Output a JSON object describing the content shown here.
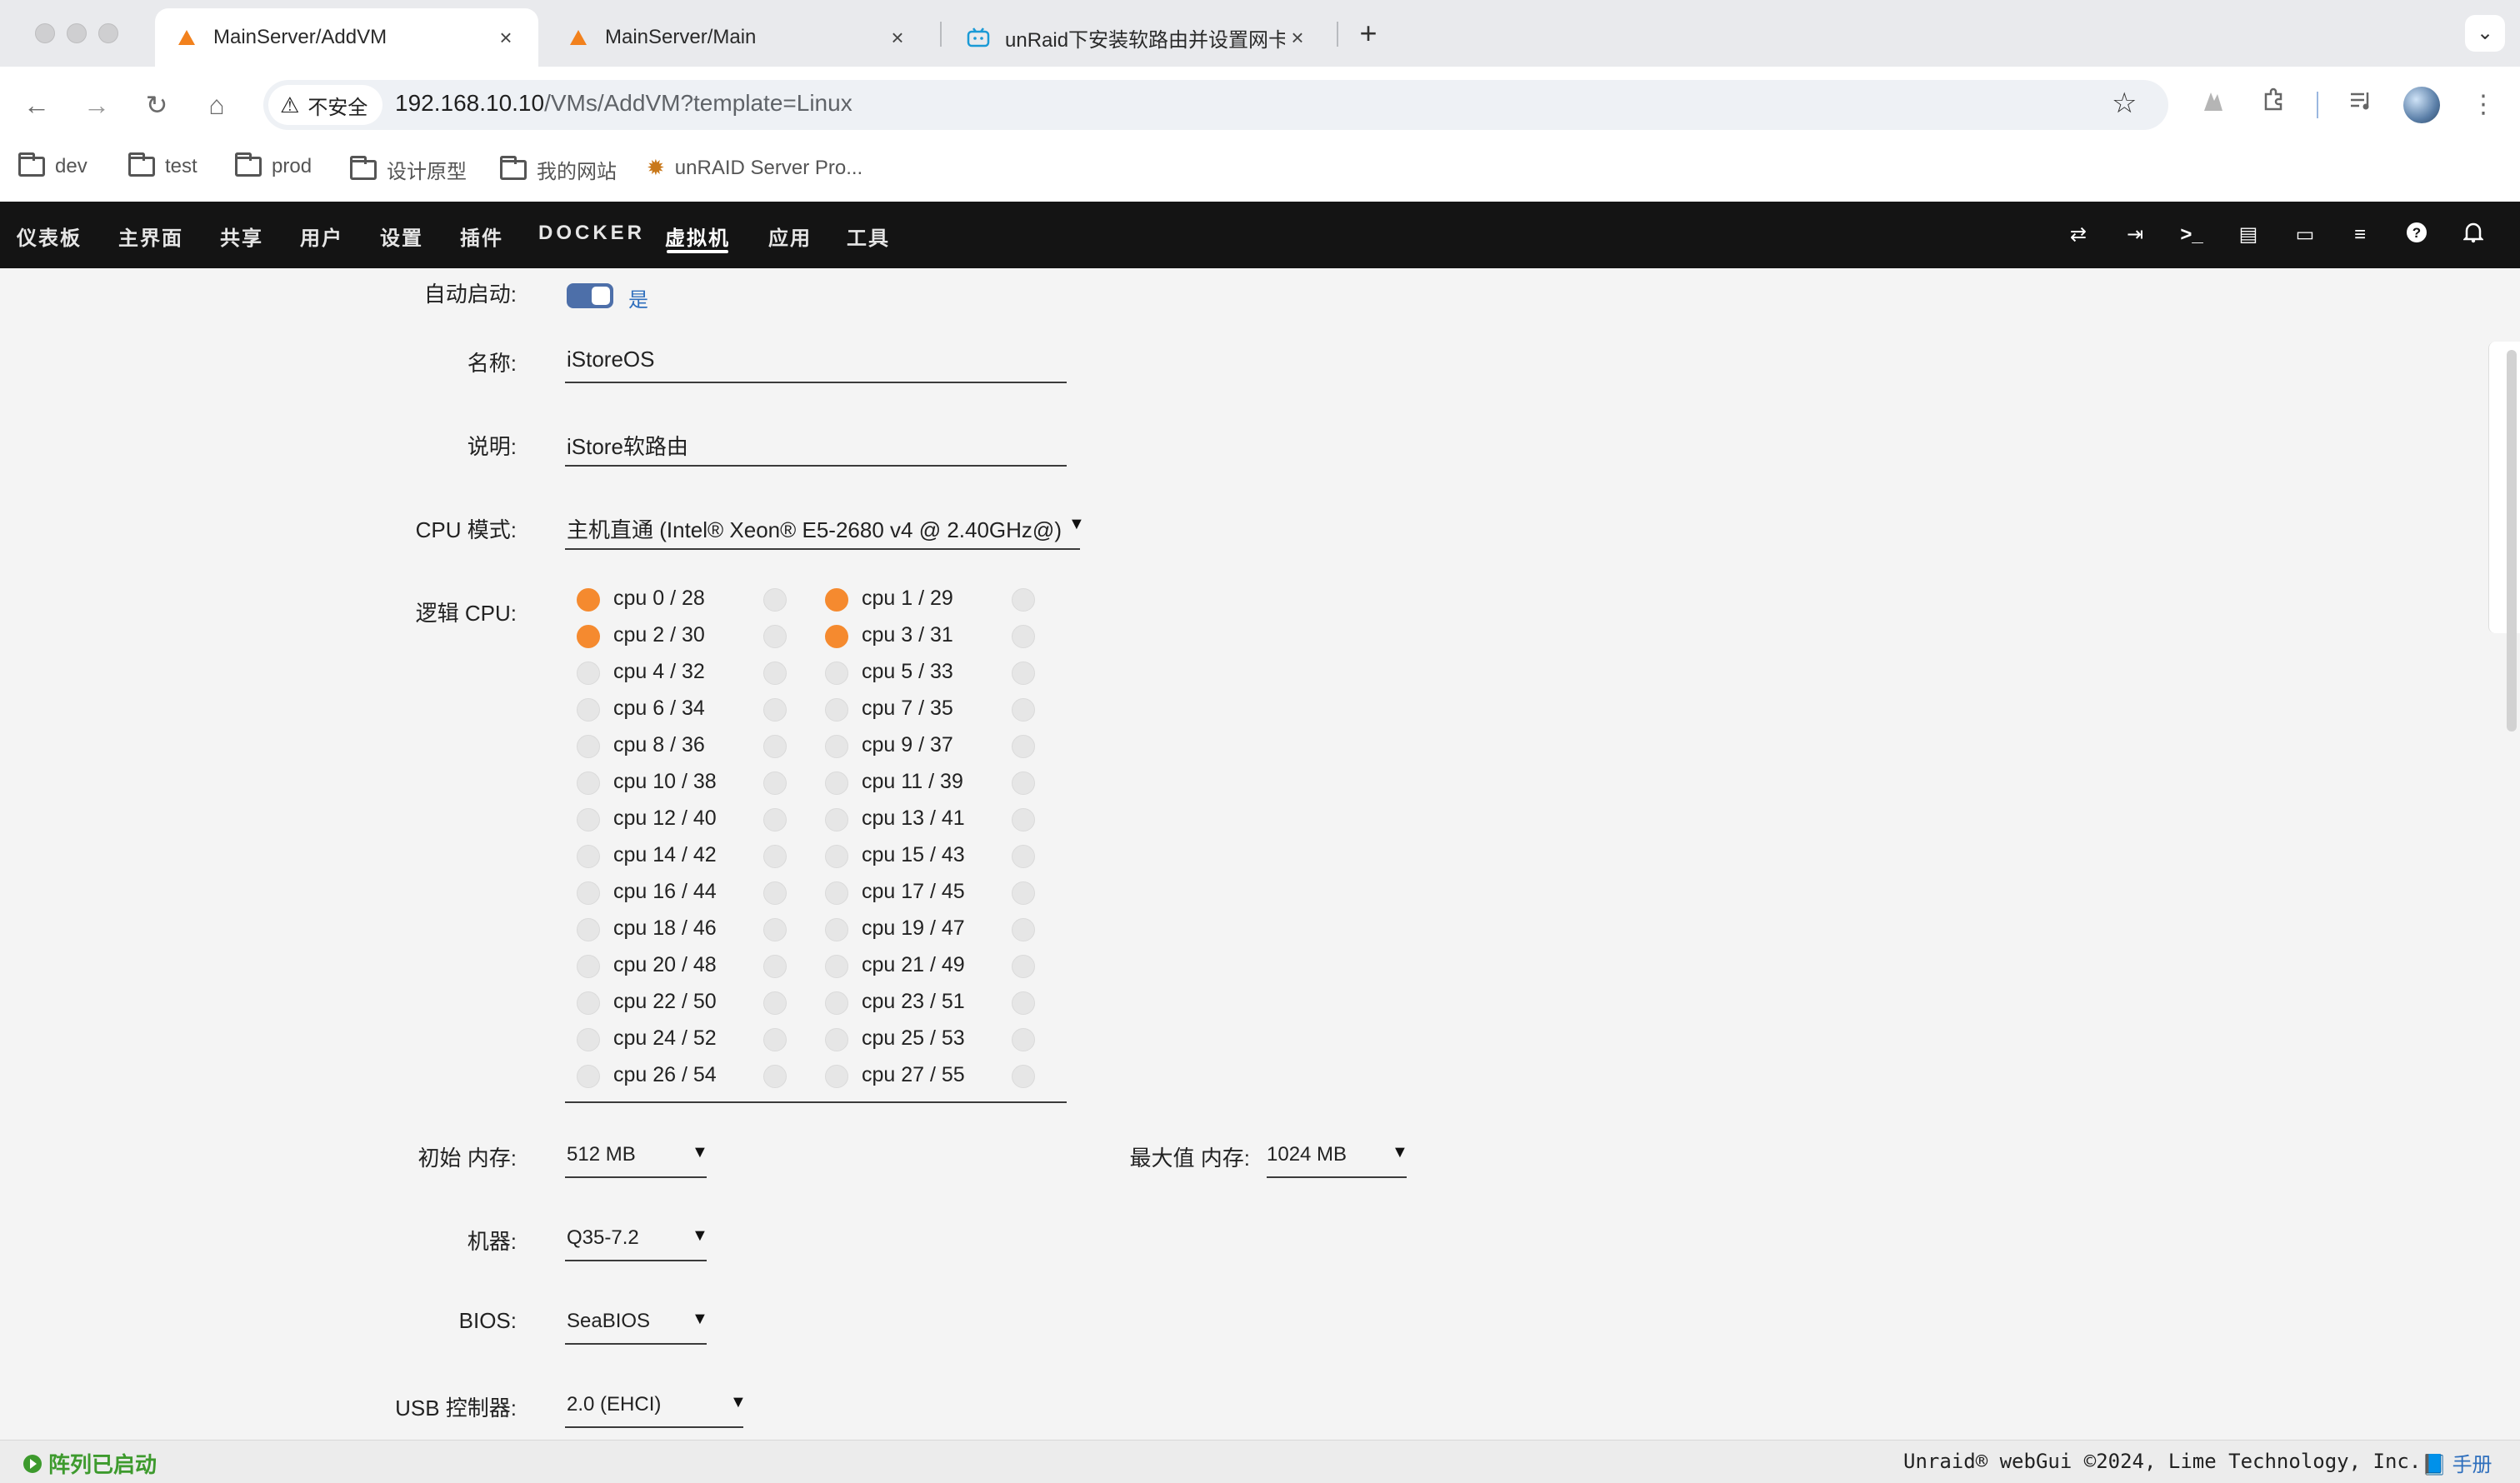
{
  "browser": {
    "tabs": [
      {
        "title": "MainServer/AddVM",
        "favicon": "unraid-logo-icon",
        "active": true
      },
      {
        "title": "MainServer/Main",
        "favicon": "unraid-logo-icon",
        "active": false
      },
      {
        "title": "unRaid下安装软路由并设置网卡",
        "favicon": "bilibili-icon",
        "active": false
      }
    ],
    "new_tab": "+",
    "close_glyph": "×",
    "security_label": "不安全",
    "url_host": "192.168.10.10",
    "url_path": "/VMs/AddVM?template=Linux",
    "bookmarks": [
      {
        "label": "dev",
        "icon": "folder-icon"
      },
      {
        "label": "test",
        "icon": "folder-icon"
      },
      {
        "label": "prod",
        "icon": "folder-icon"
      },
      {
        "label": "设计原型",
        "icon": "folder-icon"
      },
      {
        "label": "我的网站",
        "icon": "folder-icon"
      },
      {
        "label": "unRAID Server Pro...",
        "icon": "sun-favicon-icon"
      }
    ]
  },
  "unraid_nav": {
    "items": [
      "仪表板",
      "主界面",
      "共享",
      "用户",
      "设置",
      "插件",
      "DOCKER",
      "虚拟机",
      "应用",
      "工具"
    ],
    "active": "虚拟机",
    "right_icons": [
      "loop-icon",
      "logout-icon",
      "terminal-icon",
      "feedback-icon",
      "monitor-icon",
      "log-icon",
      "help-icon",
      "bell-icon"
    ]
  },
  "form": {
    "autostart": {
      "label": "自动启动:",
      "value": "是",
      "enabled": true
    },
    "name": {
      "label": "名称:",
      "value": "iStoreOS"
    },
    "description": {
      "label": "说明:",
      "value": "iStore软路由"
    },
    "cpu_mode": {
      "label": "CPU 模式:",
      "value": "主机直通 (Intel® Xeon® E5-2680 v4 @ 2.40GHz@)"
    },
    "logical_cpu": {
      "label": "逻辑 CPU:",
      "left": [
        "cpu 0 / 28",
        "cpu 2 / 30",
        "cpu 4 / 32",
        "cpu 6 / 34",
        "cpu 8 / 36",
        "cpu 10 / 38",
        "cpu 12 / 40",
        "cpu 14 / 42",
        "cpu 16 / 44",
        "cpu 18 / 46",
        "cpu 20 / 48",
        "cpu 22 / 50",
        "cpu 24 / 52",
        "cpu 26 / 54"
      ],
      "right": [
        "cpu 1 / 29",
        "cpu 3 / 31",
        "cpu 5 / 33",
        "cpu 7 / 35",
        "cpu 9 / 37",
        "cpu 11 / 39",
        "cpu 13 / 41",
        "cpu 15 / 43",
        "cpu 17 / 45",
        "cpu 19 / 47",
        "cpu 21 / 49",
        "cpu 23 / 51",
        "cpu 25 / 53",
        "cpu 27 / 55"
      ],
      "selected": [
        "cpu 0 / 28",
        "cpu 1 / 29",
        "cpu 2 / 30",
        "cpu 3 / 31"
      ]
    },
    "initial_memory": {
      "label": "初始 内存:",
      "value": "512 MB"
    },
    "max_memory": {
      "label": "最大值 内存:",
      "value": "1024 MB"
    },
    "machine": {
      "label": "机器:",
      "value": "Q35-7.2"
    },
    "bios": {
      "label": "BIOS:",
      "value": "SeaBIOS"
    },
    "usb_controller": {
      "label": "USB 控制器:",
      "value": "2.0 (EHCI)"
    }
  },
  "footer": {
    "status": "阵列已启动",
    "copyright": "Unraid® webGui ©2024, Lime Technology, Inc.",
    "manual": "手册"
  },
  "colors": {
    "selected_cpu": "#f58a2f",
    "unselected_cpu": "#e6e6e6",
    "nav_bg": "#141414",
    "toggle": "#4d6fa9",
    "status_green": "#3d9a2d",
    "link_blue": "#2f6fbd"
  }
}
